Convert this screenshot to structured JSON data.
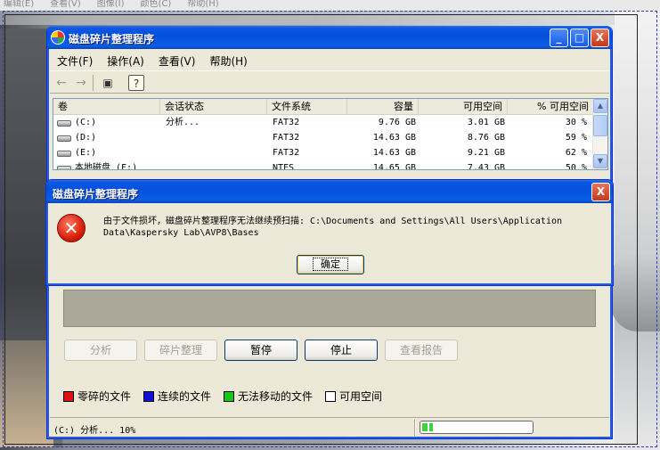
{
  "host_menu": [
    "编辑(E)",
    "查看(V)",
    "图像(I)",
    "颜色(C)",
    "帮助(H)"
  ],
  "window": {
    "title": "磁盘碎片整理程序",
    "minimize": "_",
    "maximize": "□",
    "close": "X"
  },
  "menubar": [
    "文件(F)",
    "操作(A)",
    "查看(V)",
    "帮助(H)"
  ],
  "toolbar": {
    "back": "←",
    "forward": "→",
    "view": "▣",
    "help": "?"
  },
  "list": {
    "columns": [
      "卷",
      "会话状态",
      "文件系统",
      "容量",
      "可用空间",
      "% 可用空间"
    ],
    "rows": [
      {
        "volume": "(C:)",
        "status": "分析...",
        "fs": "FAT32",
        "capacity": "9.76 GB",
        "free": "3.01 GB",
        "pct": "30 %"
      },
      {
        "volume": "(D:)",
        "status": "",
        "fs": "FAT32",
        "capacity": "14.63 GB",
        "free": "8.76 GB",
        "pct": "59 %"
      },
      {
        "volume": "(E:)",
        "status": "",
        "fs": "FAT32",
        "capacity": "14.63 GB",
        "free": "9.21 GB",
        "pct": "62 %"
      },
      {
        "volume": "本地磁盘 (F:)",
        "status": "",
        "fs": "NTFS",
        "capacity": "14.65 GB",
        "free": "7.43 GB",
        "pct": "50 %"
      }
    ]
  },
  "buttons": {
    "analyze": "分析",
    "defrag": "碎片整理",
    "pause": "暂停",
    "stop": "停止",
    "report": "查看报告"
  },
  "legend": [
    {
      "label": "零碎的文件",
      "color": "#e01010"
    },
    {
      "label": "连续的文件",
      "color": "#1010d0"
    },
    {
      "label": "无法移动的文件",
      "color": "#18c818"
    },
    {
      "label": "可用空间",
      "color": "#ffffff"
    }
  ],
  "status": {
    "text": "(C:) 分析... 10%",
    "progress": 0.1
  },
  "dialog": {
    "title": "磁盘碎片整理程序",
    "close": "X",
    "icon": "✕",
    "message": "由于文件损坏，磁盘碎片整理程序无法继续预扫描: C:\\Documents and Settings\\All Users\\Application Data\\Kaspersky Lab\\AVP8\\Bases",
    "ok": "确定"
  }
}
